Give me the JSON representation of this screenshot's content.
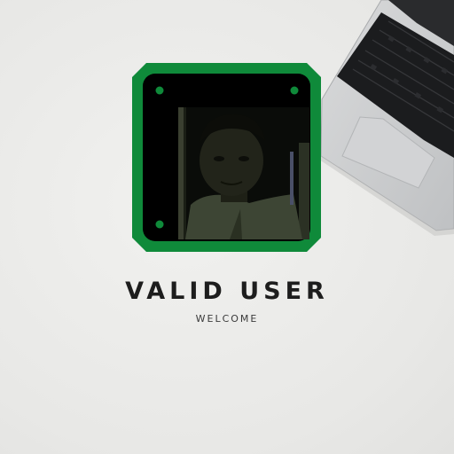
{
  "status": {
    "title": "VALID USER",
    "subtitle": "WELCOME"
  },
  "frame": {
    "border_color": "#0f8a3a",
    "inner_color": "#000000",
    "dot_color": "#0f8a3a"
  },
  "icons": {
    "laptop": "laptop-icon",
    "camera_feed": "camera-feed"
  }
}
